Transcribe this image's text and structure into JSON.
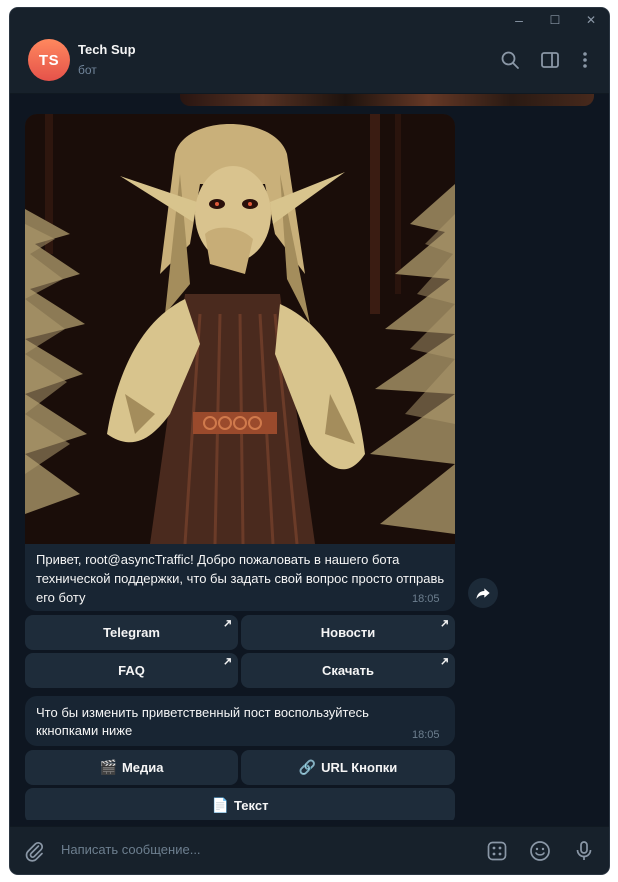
{
  "window": {
    "controls": {
      "minimize": "–",
      "maximize": "☐",
      "close": "✕"
    }
  },
  "header": {
    "avatar_initials": "TS",
    "title": "Tech Sup",
    "status": "бот",
    "icons": [
      "search-icon",
      "sidebar-panel-icon",
      "more-vertical-icon"
    ]
  },
  "messages": {
    "welcome": {
      "text": "Привет, root@asyncTraffic! Добро пожаловать в нашего бота технической поддержки, что бы задать свой вопрос просто отправь его боту",
      "time": "18:05",
      "buttons": [
        {
          "label": "Telegram",
          "external": true
        },
        {
          "label": "Новости",
          "external": true
        },
        {
          "label": "FAQ",
          "external": true
        },
        {
          "label": "Скачать",
          "external": true
        }
      ]
    },
    "edit": {
      "text": "Что бы изменить приветственный пост воспользуйтесь ккнопками ниже",
      "time": "18:05",
      "buttons": [
        {
          "label": "Медиа",
          "emoji": "🎬"
        },
        {
          "label": "URL Кнопки",
          "emoji": "🔗"
        },
        {
          "label": "Текст",
          "emoji": "📄"
        }
      ]
    }
  },
  "composer": {
    "placeholder": "Написать сообщение...",
    "icons": [
      "attach-icon",
      "bot-commands-icon",
      "emoji-icon",
      "microphone-icon"
    ]
  },
  "colors": {
    "background": "#0e1621",
    "panel": "#17212b",
    "bubble": "#182533",
    "button": "#1e2c3a",
    "avatar": "#e5524a",
    "muted": "#6d7f8f"
  }
}
